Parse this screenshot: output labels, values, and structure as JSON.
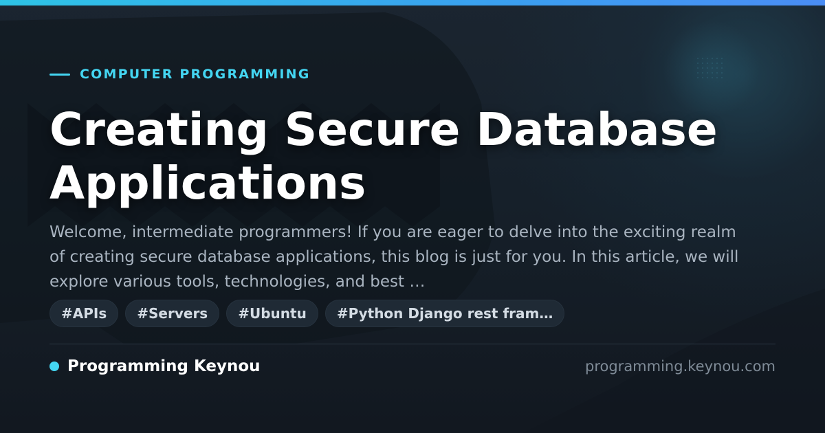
{
  "header": {
    "kicker": "COMPUTER PROGRAMMING",
    "title": "Creating Secure Database Applications"
  },
  "excerpt": "Welcome, intermediate programmers! If you are eager to delve into the exciting realm of creating secure database applications, this blog is just for you. In this article, we will explore various tools, technologies, and best …",
  "tags": [
    "#APIs",
    "#Servers",
    "#Ubuntu",
    "#Python Django rest fram…"
  ],
  "footer": {
    "brand": "Programming Keynou",
    "domain": "programming.keynou.com"
  },
  "colors": {
    "accent": "#44d6f2",
    "background": "#131a22",
    "title": "#ffffff",
    "excerpt": "#a9b4c0",
    "tag_background": "#1f2a35"
  }
}
